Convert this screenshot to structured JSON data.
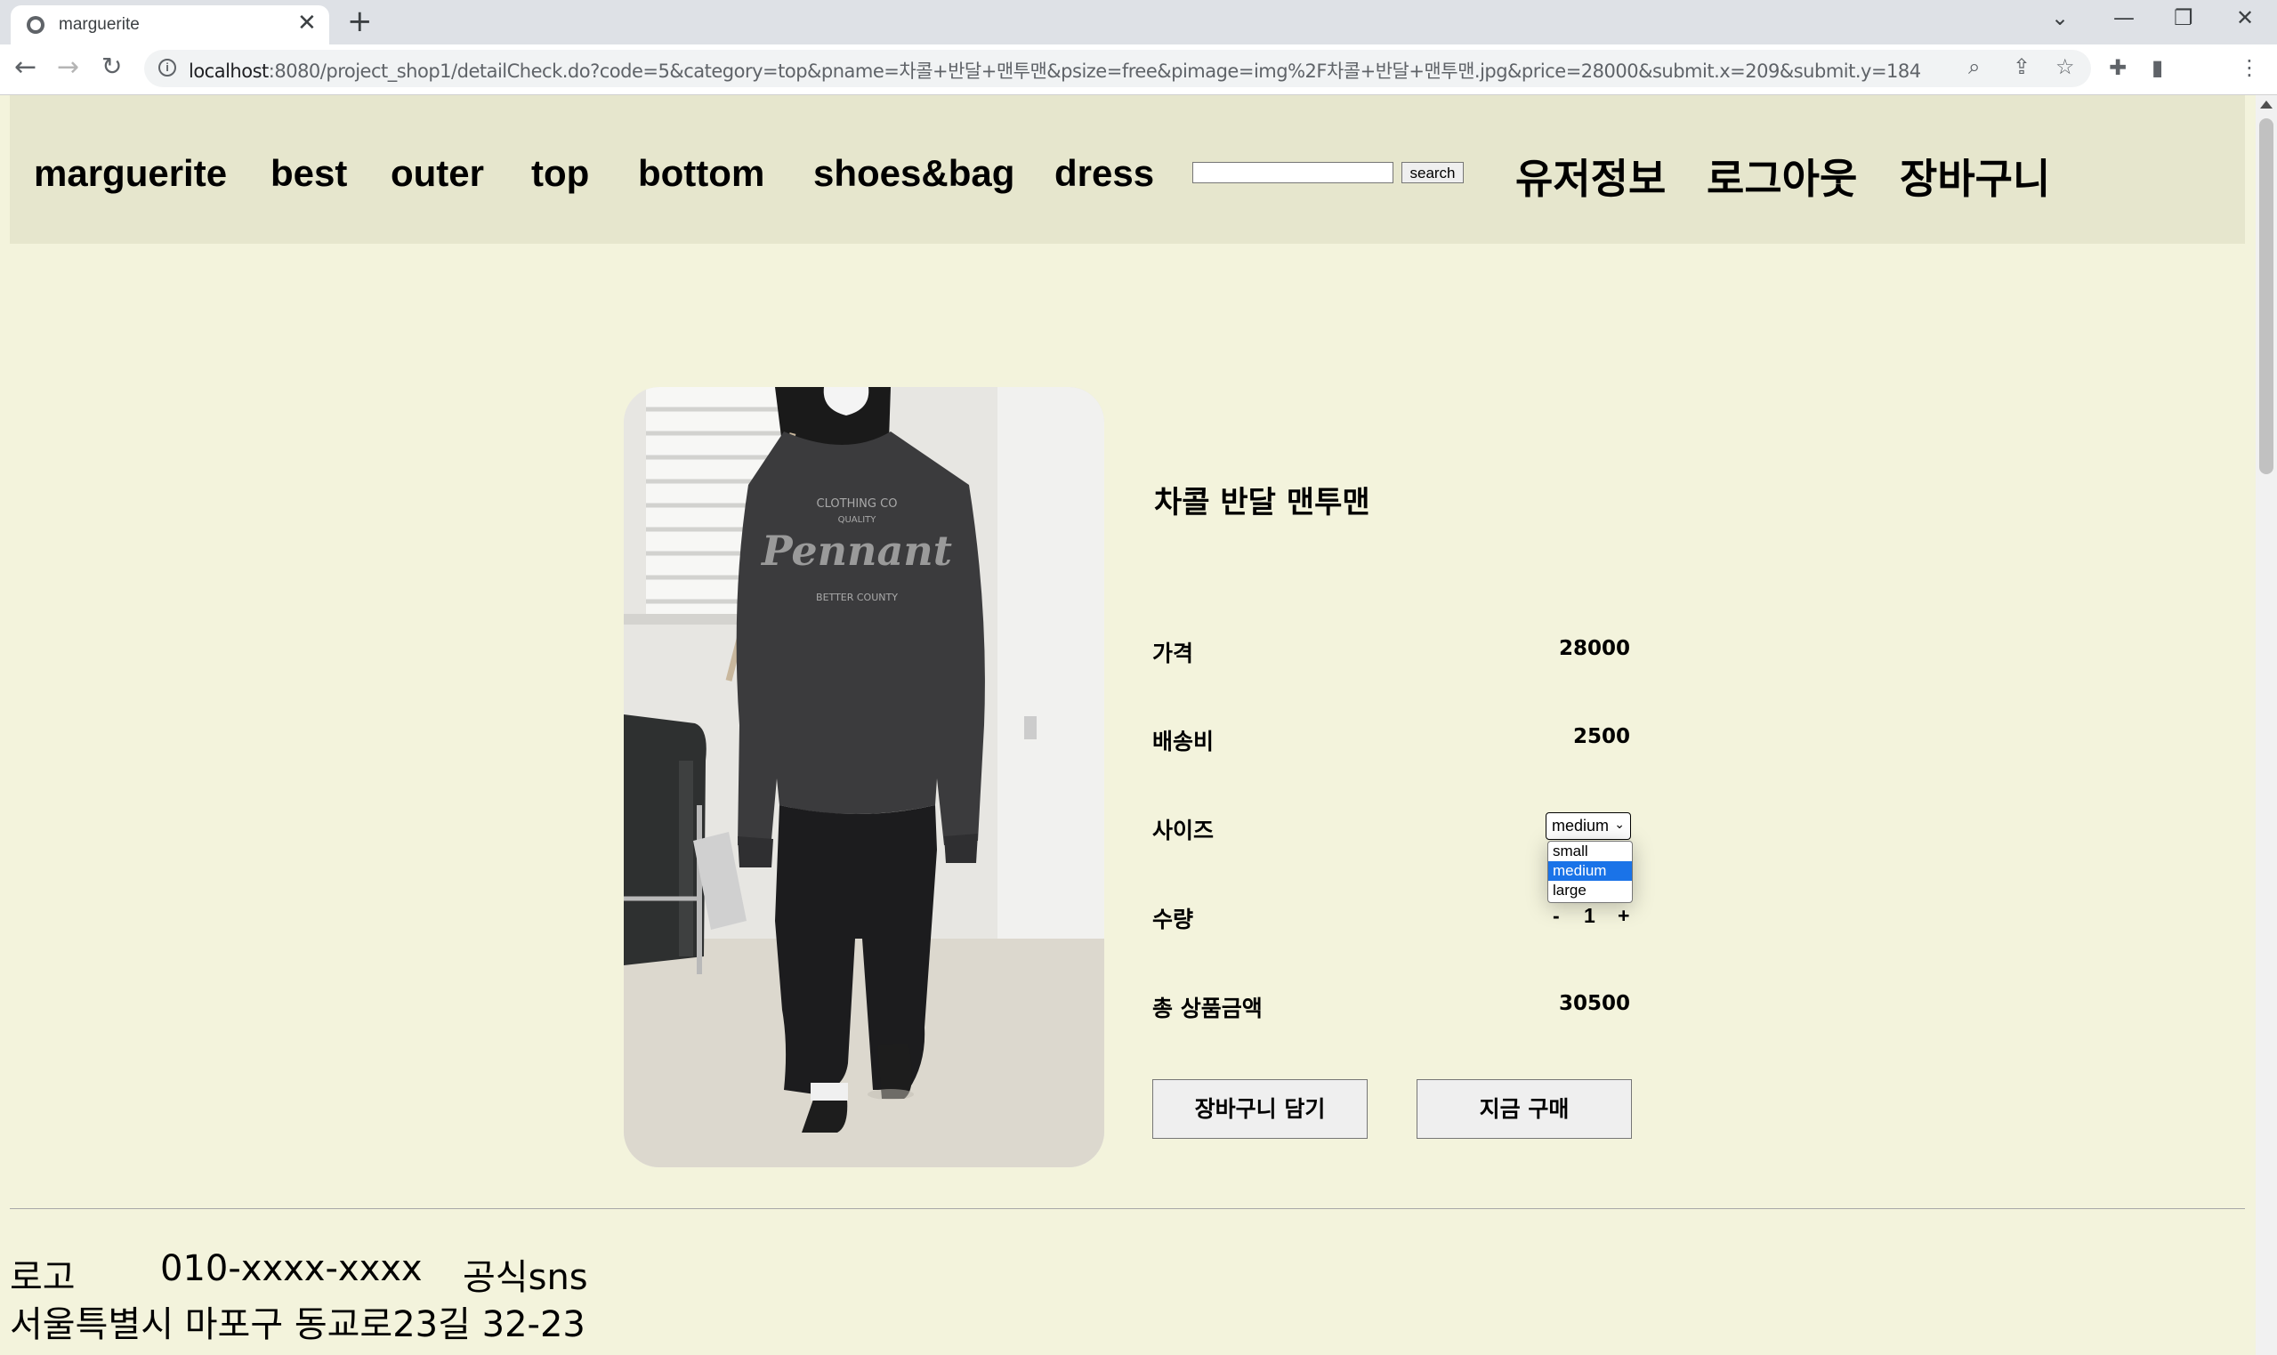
{
  "browser": {
    "tab_title": "marguerite",
    "url_host": "localhost",
    "url_rest": ":8080/project_shop1/detailCheck.do?code=5&category=top&pname=차콜+반달+맨투맨&psize=free&pimage=img%2F차콜+반달+맨투맨.jpg&price=28000&submit.x=209&submit.y=184"
  },
  "nav": {
    "brand": "marguerite",
    "menu": [
      "best",
      "outer",
      "top",
      "bottom",
      "shoes&bag",
      "dress"
    ],
    "search_button": "search",
    "search_value": "",
    "user_info": "유저정보",
    "logout": "로그아웃",
    "cart": "장바구니"
  },
  "product": {
    "name": "차콜 반달 맨투맨",
    "price_label": "가격",
    "price": "28000",
    "shipping_label": "배송비",
    "shipping": "2500",
    "size_label": "사이즈",
    "size_selected": "medium",
    "size_options": [
      "small",
      "medium",
      "large"
    ],
    "qty_label": "수량",
    "qty_minus": "-",
    "qty_value": "1",
    "qty_plus": "+",
    "total_label": "총 상품금액",
    "total": "30500",
    "add_cart_button": "장바구니 담기",
    "buy_now_button": "지금 구매",
    "shirt_print": {
      "line1": "CLOTHING CO",
      "line2": "QUALITY",
      "script": "Pennant",
      "line3": "BETTER COUNTY"
    }
  },
  "footer": {
    "logo": "로고",
    "phone": "010-xxxx-xxxx",
    "sns": "공식sns",
    "address": "서울특별시 마포구 동교로23길 32-23"
  },
  "colors": {
    "page_bg": "#f3f3dc",
    "header_bg": "#e6e6cd",
    "select_highlight": "#1a73e8"
  }
}
